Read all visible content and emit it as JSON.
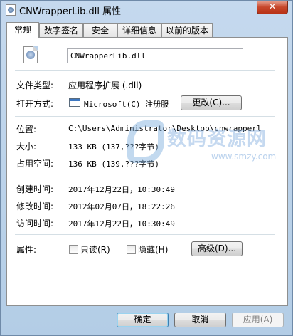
{
  "window": {
    "title": "CNWrapperLib.dll 属性",
    "close_label": "✕"
  },
  "tabs": [
    {
      "label": "常规",
      "active": true
    },
    {
      "label": "数字签名",
      "active": false
    },
    {
      "label": "安全",
      "active": false
    },
    {
      "label": "详细信息",
      "active": false
    },
    {
      "label": "以前的版本",
      "active": false
    }
  ],
  "general": {
    "file_icon": "dll-file-icon",
    "file_name": "CNWrapperLib.dll",
    "type_label": "文件类型:",
    "type_value": "应用程序扩展 (.dll)",
    "opens_with_label": "打开方式:",
    "opens_with_icon": "application-icon",
    "opens_with_value": "Microsoft(C) 注册服",
    "change_button": "更改(C)...",
    "location_label": "位置:",
    "location_value": "C:\\Users\\Administrator\\Desktop\\cnwrapperl",
    "size_label": "大小:",
    "size_value": "133 KB (137,???字节)",
    "size_on_disk_label": "占用空间:",
    "size_on_disk_value": "136 KB (139,???字节)",
    "created_label": "创建时间:",
    "created_value": "2017年12月22日，10:30:49",
    "modified_label": "修改时间:",
    "modified_value": "2012年02月07日，18:22:26",
    "accessed_label": "访问时间:",
    "accessed_value": "2017年12月22日，10:30:49",
    "attributes_label": "属性:",
    "readonly_label": "只读(R)",
    "readonly_checked": false,
    "hidden_label": "隐藏(H)",
    "hidden_checked": false,
    "advanced_button": "高级(D)..."
  },
  "watermark": {
    "text": "数码资源网",
    "url": "www.smzy.com"
  },
  "footer": {
    "ok": "确定",
    "cancel": "取消",
    "apply": "应用(A)"
  }
}
